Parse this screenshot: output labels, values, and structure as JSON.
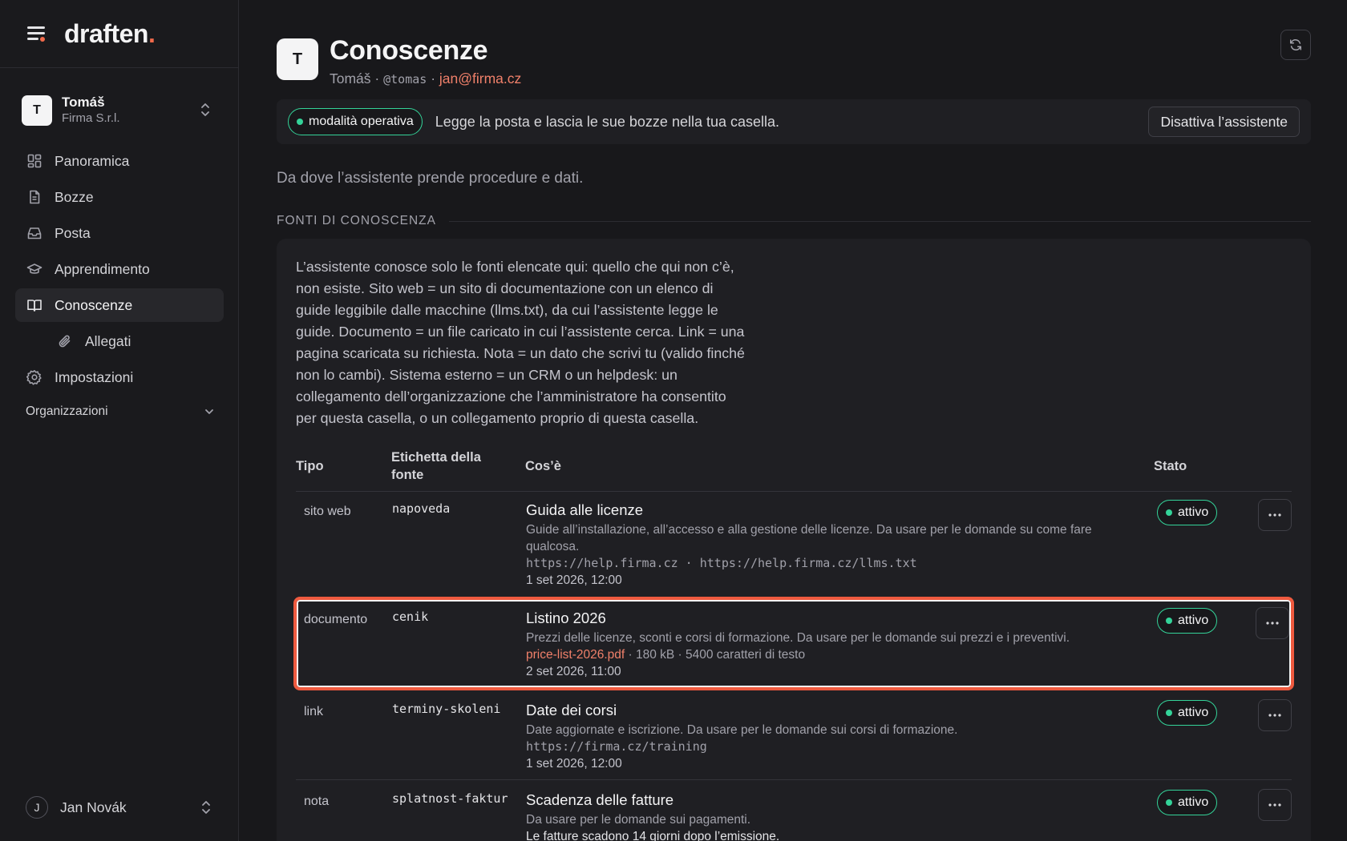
{
  "app": {
    "logo_text": "draften",
    "logo_dot": ".",
    "accent_color": "#f26a4b"
  },
  "account": {
    "initial": "T",
    "name": "Tomáš",
    "org": "Firma S.r.l."
  },
  "nav": {
    "items": [
      {
        "label": "Panoramica",
        "icon": "dashboard-icon"
      },
      {
        "label": "Bozze",
        "icon": "document-icon"
      },
      {
        "label": "Posta",
        "icon": "inbox-icon"
      },
      {
        "label": "Apprendimento",
        "icon": "graduation-cap-icon"
      },
      {
        "label": "Conoscenze",
        "icon": "book-icon",
        "active": true
      },
      {
        "label": "Allegati",
        "icon": "paperclip-icon",
        "sub": true
      },
      {
        "label": "Impostazioni",
        "icon": "gear-icon"
      }
    ],
    "organizations_label": "Organizzazioni"
  },
  "footer_user": {
    "initial": "J",
    "name": "Jan Novák"
  },
  "page": {
    "initial": "T",
    "title": "Conoscenze",
    "owner": "Tomáš",
    "separator": "·",
    "handle": "@tomas",
    "email": "jan@firma.cz"
  },
  "status": {
    "mode_label": "modalità operativa",
    "mode_color": "#34d399",
    "text": "Legge la posta e lascia le sue bozze nella tua casella.",
    "deactivate_label": "Disattiva l’assistente"
  },
  "intro": "Da dove l’assistente prende procedure e dati.",
  "section_title": "FONTI DI CONOSCENZA",
  "description_lines": [
    "L’assistente conosce solo le fonti elencate qui: quello che qui non c’è,",
    "non esiste. Sito web = un sito di documentazione con un elenco di",
    "guide leggibile dalle macchine (llms.txt), da cui l’assistente legge le",
    "guide. Documento = un file caricato in cui l’assistente cerca. Link = una",
    "pagina scaricata su richiesta. Nota = un dato che scrivi tu (valido finché",
    "non lo cambi). Sistema esterno = un CRM o un helpdesk: un",
    "collegamento dell’organizzazione che l’amministratore ha consentito",
    "per questa casella, o un collegamento proprio di questa casella."
  ],
  "table": {
    "headers": {
      "type": "Tipo",
      "label_l1": "Etichetta della",
      "label_l2": "fonte",
      "what": "Cos’è",
      "state": "Stato"
    },
    "rows": [
      {
        "type": "sito web",
        "label": "napoveda",
        "title": "Guida alle licenze",
        "desc_l1": "Guide all’installazione, all’accesso e alla gestione delle licenze. Da usare per le domande su come fare",
        "desc_l2": "qualcosa.",
        "url": "https://help.firma.cz · https://help.firma.cz/llms.txt",
        "date": "1 set 2026, 12:00",
        "state": "attivo"
      },
      {
        "type": "documento",
        "label": "cenik",
        "title": "Listino 2026",
        "desc_l1": "Prezzi delle licenze, sconti e corsi di formazione. Da usare per le domande sui prezzi e i preventivi.",
        "file": "price-list-2026.pdf",
        "file_meta": " · 180 kB · 5400 caratteri di testo",
        "date": "2 set 2026, 11:00",
        "state": "attivo"
      },
      {
        "type": "link",
        "label": "terminy-skoleni",
        "title": "Date dei corsi",
        "desc_l1": "Date aggiornate e iscrizione. Da usare per le domande sui corsi di formazione.",
        "url": "https://firma.cz/training",
        "date": "1 set 2026, 12:00",
        "state": "attivo"
      },
      {
        "type": "nota",
        "label": "splatnost-faktur",
        "title": "Scadenza delle fatture",
        "desc_l1": "Da usare per le domande sui pagamenti.",
        "extra": "Le fatture scadono 14 giorni dopo l’emissione.",
        "state": "attivo"
      }
    ]
  }
}
